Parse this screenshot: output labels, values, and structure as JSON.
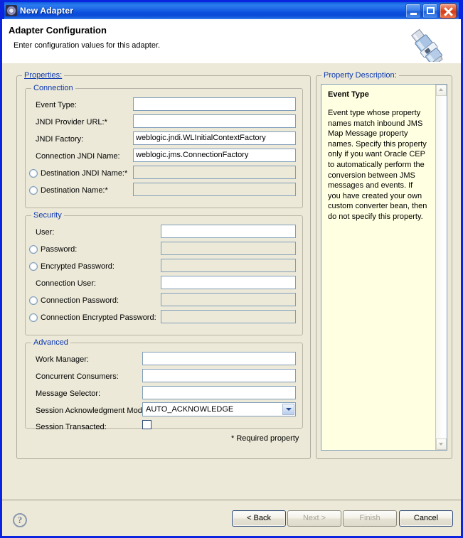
{
  "window": {
    "title": "New Adapter",
    "icon": "gear-icon",
    "minimize_label": "Minimize",
    "maximize_label": "Maximize",
    "close_label": "Close"
  },
  "header": {
    "title": "Adapter Configuration",
    "subtitle": "Enter configuration values for this adapter.",
    "icon": "adapter-plug-icon"
  },
  "properties": {
    "legend": "Properties:",
    "required_note": "* Required property",
    "connection": {
      "legend": "Connection",
      "fields": [
        {
          "label": "Event Type:",
          "value": "",
          "enabled": true,
          "radio": false
        },
        {
          "label": "JNDI Provider URL:*",
          "value": "",
          "enabled": true,
          "radio": false
        },
        {
          "label": "JNDI Factory:",
          "value": "weblogic.jndi.WLInitialContextFactory",
          "enabled": true,
          "radio": false
        },
        {
          "label": "Connection JNDI Name:",
          "value": "weblogic.jms.ConnectionFactory",
          "enabled": true,
          "radio": false
        },
        {
          "label": "Destination JNDI Name:*",
          "value": "",
          "enabled": false,
          "radio": true,
          "selected": false
        },
        {
          "label": "Destination Name:*",
          "value": "",
          "enabled": false,
          "radio": true,
          "selected": false
        }
      ]
    },
    "security": {
      "legend": "Security",
      "fields": [
        {
          "label": "User:",
          "value": "",
          "enabled": true,
          "radio": false
        },
        {
          "label": "Password:",
          "value": "",
          "enabled": false,
          "radio": true,
          "selected": false
        },
        {
          "label": "Encrypted Password:",
          "value": "",
          "enabled": false,
          "radio": true,
          "selected": false
        },
        {
          "label": "Connection User:",
          "value": "",
          "enabled": true,
          "radio": false
        },
        {
          "label": "Connection Password:",
          "value": "",
          "enabled": false,
          "radio": true,
          "selected": false
        },
        {
          "label": "Connection Encrypted Password:",
          "value": "",
          "enabled": false,
          "radio": true,
          "selected": false
        }
      ]
    },
    "advanced": {
      "legend": "Advanced",
      "fields": [
        {
          "label": "Work Manager:",
          "value": ""
        },
        {
          "label": "Concurrent Consumers:",
          "value": ""
        },
        {
          "label": "Message Selector:",
          "value": ""
        }
      ],
      "session_ack_mode": {
        "label": "Session Acknowledgment Mode:",
        "value": "AUTO_ACKNOWLEDGE",
        "options": [
          "AUTO_ACKNOWLEDGE"
        ]
      },
      "session_transacted": {
        "label": "Session Transacted:",
        "checked": false
      }
    }
  },
  "property_description": {
    "legend": "Property Description:",
    "heading": "Event Type",
    "text": "Event type whose property names match inbound JMS Map Message property names. Specify this property only if you want Oracle CEP to automatically perform the conversion between JMS messages and events. If you have created your own custom converter bean, then do not specify this property."
  },
  "footer": {
    "help_icon": "help-question-icon",
    "buttons": [
      {
        "name": "back",
        "label": "< Back",
        "enabled": true,
        "default": true
      },
      {
        "name": "next",
        "label": "Next >",
        "enabled": false,
        "default": false
      },
      {
        "name": "finish",
        "label": "Finish",
        "enabled": false,
        "default": false
      },
      {
        "name": "cancel",
        "label": "Cancel",
        "enabled": true,
        "default": true
      }
    ]
  },
  "colors": {
    "titlebar": "#0B56DE",
    "dialog_bg": "#ECE9D8",
    "group_legend": "#0B38B0",
    "field_border": "#7F9DB9",
    "tooltip_bg": "#FFFFE1"
  }
}
